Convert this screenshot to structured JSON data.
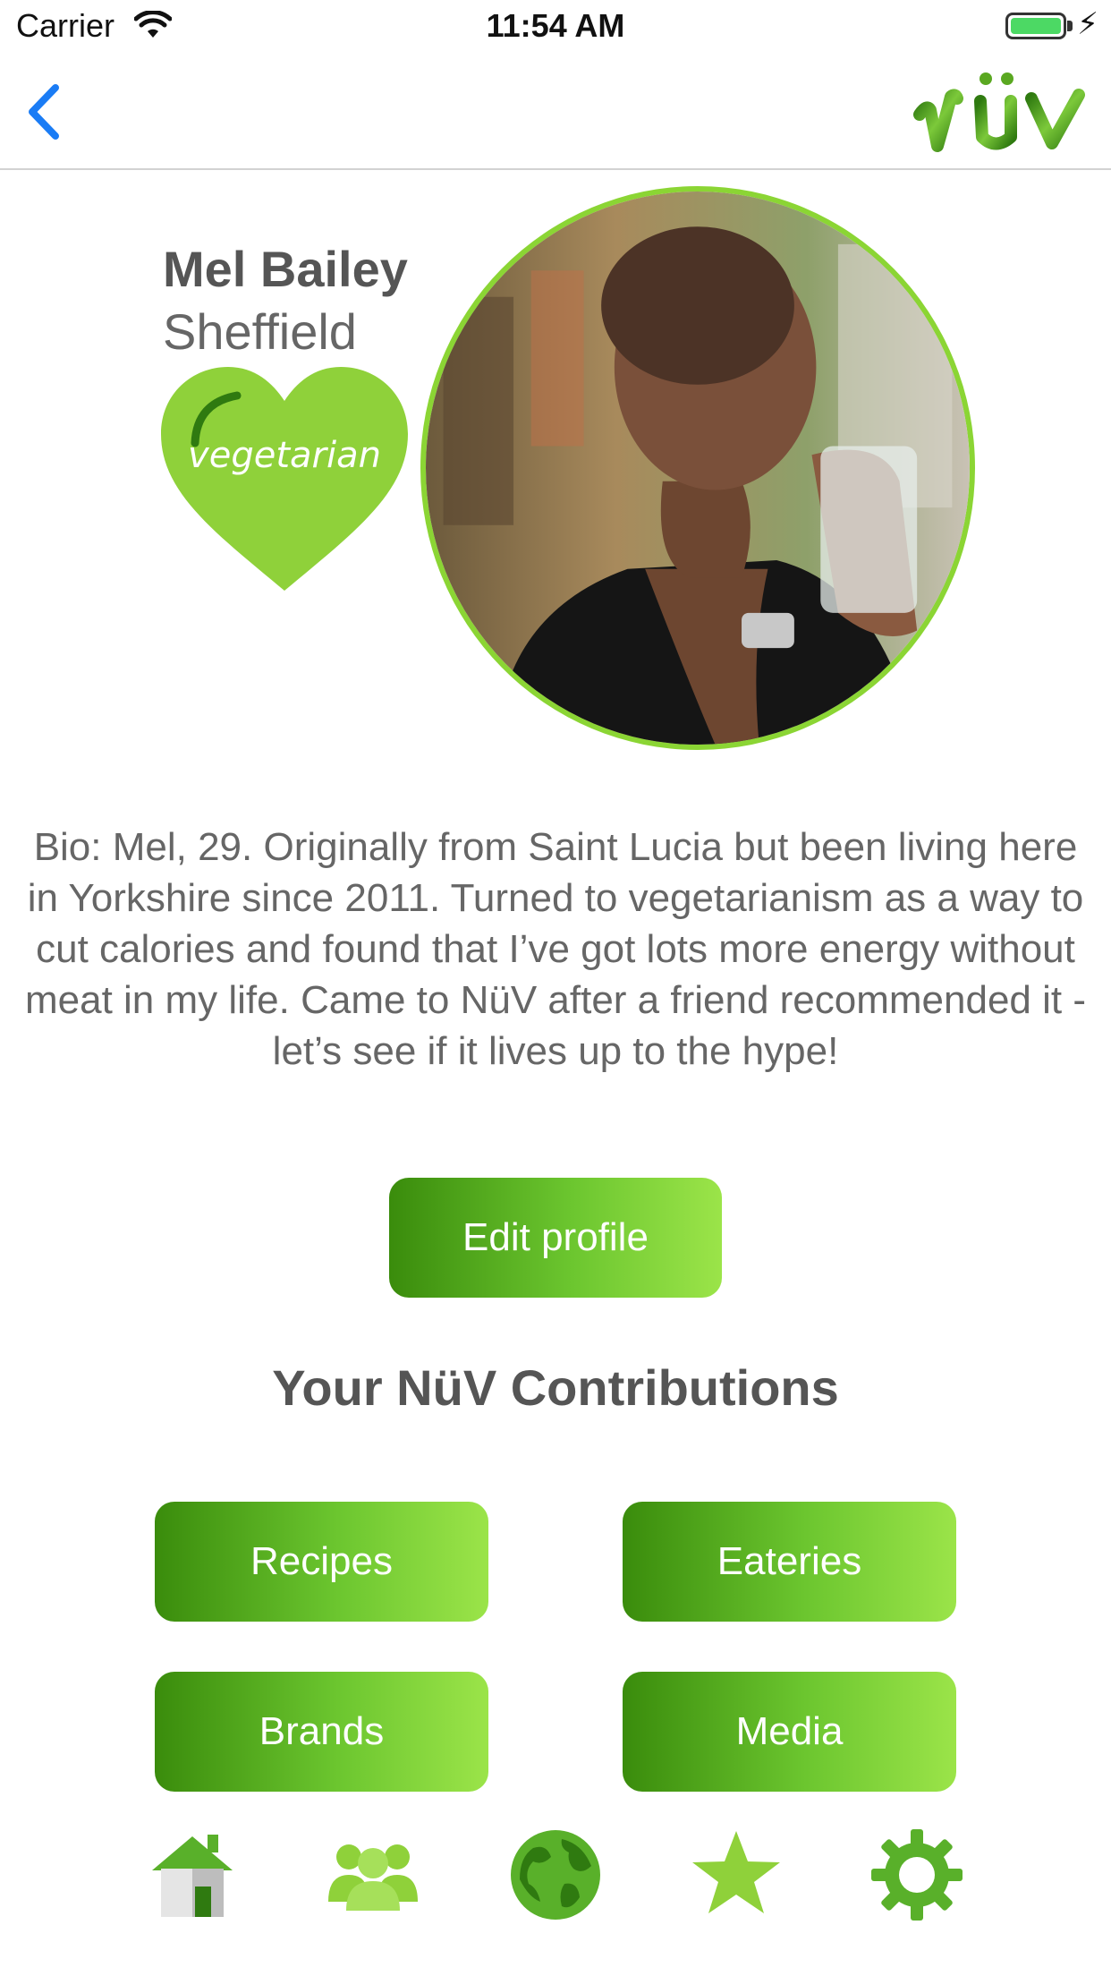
{
  "status_bar": {
    "carrier": "Carrier",
    "time": "11:54 AM"
  },
  "nav": {
    "back_icon": "chevron-left-icon",
    "logo_alt": "NüV"
  },
  "profile": {
    "name": "Mel Bailey",
    "city": "Sheffield",
    "diet": "vegetarian",
    "bio": "Bio: Mel, 29. Originally from Saint Lucia but been living here in Yorkshire since 2011. Turned to vegetarianism as a way to cut calories and found that I’ve got lots more energy without meat in my life. Came to NüV after a friend recommended it - let’s see if it lives up to the hype!"
  },
  "actions": {
    "edit_profile": "Edit profile"
  },
  "contributions": {
    "title": "Your NüV Contributions",
    "buttons": [
      "Recipes",
      "Eateries",
      "Brands",
      "Media"
    ]
  },
  "tab_bar": {
    "items": [
      "home-icon",
      "community-icon",
      "globe-icon",
      "favorites-star-icon",
      "settings-gear-icon"
    ]
  },
  "colors": {
    "brand_green_dark": "#3a8c0c",
    "brand_green_light": "#9be449",
    "accent_blue": "#1a7cf5",
    "text_gray": "#555555"
  }
}
